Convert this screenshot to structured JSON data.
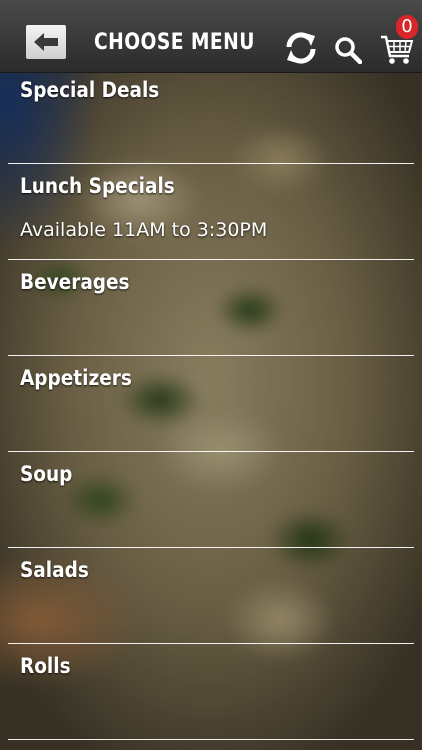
{
  "header": {
    "title": "CHOOSE MENU",
    "cart_count": "0",
    "back_icon": "back-arrow-icon",
    "refresh_icon": "refresh-icon",
    "search_icon": "search-icon",
    "cart_icon": "cart-icon"
  },
  "colors": {
    "header_bg": "#333333",
    "badge": "#d9262a",
    "text": "#ffffff"
  },
  "menu": {
    "items": [
      {
        "label": "Special Deals",
        "subtitle": ""
      },
      {
        "label": "Lunch Specials",
        "subtitle": "Available 11AM to 3:30PM"
      },
      {
        "label": "Beverages",
        "subtitle": ""
      },
      {
        "label": "Appetizers",
        "subtitle": ""
      },
      {
        "label": "Soup",
        "subtitle": ""
      },
      {
        "label": "Salads",
        "subtitle": ""
      },
      {
        "label": "Rolls",
        "subtitle": ""
      }
    ]
  }
}
